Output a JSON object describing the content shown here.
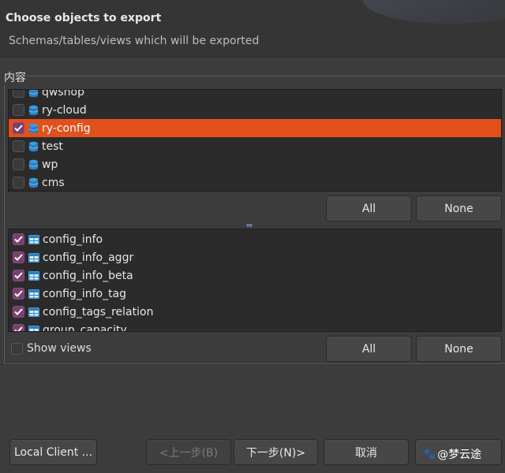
{
  "header": {
    "title": "Choose objects to export",
    "subtitle": "Schemas/tables/views which will be exported"
  },
  "group": {
    "label": "内容"
  },
  "schemas": [
    {
      "name": "qwshop",
      "checked": false,
      "selected": false
    },
    {
      "name": "ry-cloud",
      "checked": false,
      "selected": false
    },
    {
      "name": "ry-config",
      "checked": true,
      "selected": true
    },
    {
      "name": "test",
      "checked": false,
      "selected": false
    },
    {
      "name": "wp",
      "checked": false,
      "selected": false
    },
    {
      "name": "cms",
      "checked": false,
      "selected": false
    }
  ],
  "tables": [
    {
      "name": "config_info",
      "checked": true
    },
    {
      "name": "config_info_aggr",
      "checked": true
    },
    {
      "name": "config_info_beta",
      "checked": true
    },
    {
      "name": "config_info_tag",
      "checked": true
    },
    {
      "name": "config_tags_relation",
      "checked": true
    },
    {
      "name": "group_capacity",
      "checked": true
    }
  ],
  "buttons": {
    "all_top": "All",
    "none_top": "None",
    "all_bottom": "All",
    "none_bottom": "None"
  },
  "show_views": {
    "label": "Show views",
    "checked": false
  },
  "footer": {
    "local_client": "Local Client ...",
    "back": "<上一步(B)",
    "next": "下一步(N)>",
    "cancel": "取消"
  },
  "watermark": "@梦云途",
  "colors": {
    "selection": "#e2501c",
    "checkbox_checked": "#7b3f6e",
    "db_icon": "#3d9de0",
    "table_icon": "#3d9de0"
  },
  "icons": {
    "schema": "database-icon",
    "table": "table-icon"
  }
}
